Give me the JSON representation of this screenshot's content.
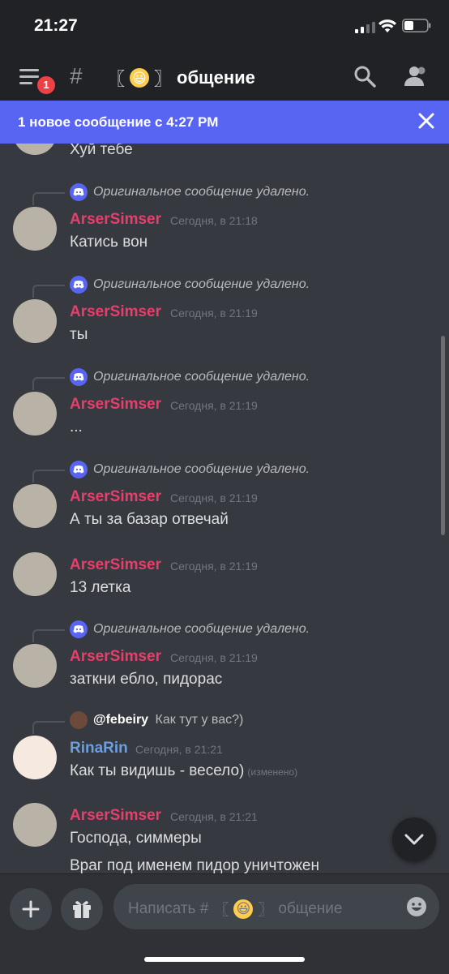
{
  "status_bar": {
    "time": "21:27"
  },
  "header": {
    "badge_count": "1",
    "channel_prefix": "#",
    "bracket_left": "〖",
    "bracket_right": "〗",
    "channel_name": "общение"
  },
  "banner": {
    "text": "1 новое сообщение с 4:27 PM"
  },
  "messages": [
    {
      "content": "Хуй тебе"
    },
    {
      "reply": "Оригинальное сообщение удалено.",
      "author": "ArserSimser",
      "time": "Сегодня, в 21:18",
      "content": "Катись вон"
    },
    {
      "reply": "Оригинальное сообщение удалено.",
      "author": "ArserSimser",
      "time": "Сегодня, в 21:19",
      "content": "ты"
    },
    {
      "reply": "Оригинальное сообщение удалено.",
      "author": "ArserSimser",
      "time": "Сегодня, в 21:19",
      "content": "..."
    },
    {
      "reply": "Оригинальное сообщение удалено.",
      "author": "ArserSimser",
      "time": "Сегодня, в 21:19",
      "content": "А ты за базар отвечай"
    },
    {
      "author": "ArserSimser",
      "time": "Сегодня, в 21:19",
      "content": "13 летка"
    },
    {
      "reply": "Оригинальное сообщение удалено.",
      "author": "ArserSimser",
      "time": "Сегодня, в 21:19",
      "content": "заткни ебло, пидорас"
    },
    {
      "reply_user": "@febeiry",
      "reply_text": "Как тут у вас?)",
      "author": "RinaRin",
      "time": "Сегодня, в 21:21",
      "content": "Как ты видишь - весело)",
      "edited": "(изменено)"
    },
    {
      "author": "ArserSimser",
      "time": "Сегодня, в 21:21",
      "content": "Господа, симмеры",
      "content2": "Враг под именем пидор уничтожен"
    }
  ],
  "composer": {
    "placeholder_prefix": "Написать #",
    "channel_name": "общение"
  },
  "colors": {
    "accent": "#5865f2",
    "name_pink": "#e83e6c",
    "name_blue": "#6aa0e0",
    "background": "#36393f"
  }
}
